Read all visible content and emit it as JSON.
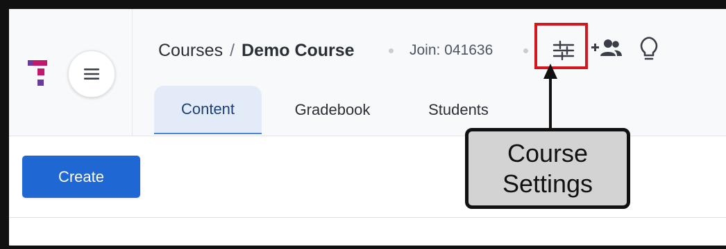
{
  "header": {
    "breadcrumb": {
      "parent": "Courses",
      "separator": "/",
      "current": "Demo Course"
    },
    "join_code": "Join: 041636",
    "icons": [
      "menu-icon",
      "sliders-icon",
      "add-people-icon",
      "lightbulb-icon"
    ]
  },
  "tabs": [
    {
      "label": "Content",
      "active": true
    },
    {
      "label": "Gradebook",
      "active": false
    },
    {
      "label": "Students",
      "active": false
    }
  ],
  "toolbar": {
    "create_label": "Create"
  },
  "annotation": {
    "line1": "Course",
    "line2": "Settings",
    "highlight_color": "#d4161e"
  },
  "colors": {
    "accent": "#1f68d4",
    "logo_magenta": "#c2196c",
    "logo_purple": "#6b3a9c",
    "active_tab_bg": "#e4ebf8"
  }
}
